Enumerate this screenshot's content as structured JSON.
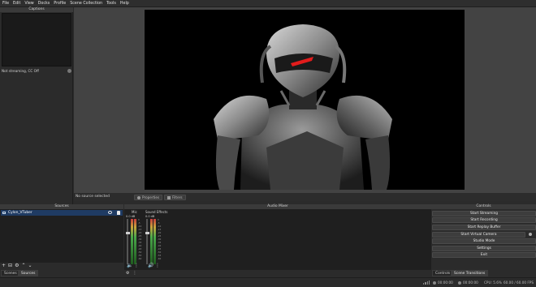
{
  "menu": [
    "File",
    "Edit",
    "View",
    "Docks",
    "Profile",
    "Scene Collection",
    "Tools",
    "Help"
  ],
  "captions": {
    "title": "Captions",
    "status": "Not streaming, CC Off"
  },
  "source_toolbar": {
    "no_source": "No source selected",
    "properties": "Properties",
    "filters": "Filters"
  },
  "sources": {
    "title": "Sources",
    "items": [
      "Cylon_VTuber"
    ],
    "toolbar_icons": [
      "+",
      "⊟",
      "⚙",
      "⌃",
      "⌄"
    ]
  },
  "tabs_left": [
    "Scenes",
    "Sources"
  ],
  "audio_mixer": {
    "title": "Audio Mixer",
    "channels": [
      {
        "name": "Mic",
        "db": "0.0 dB",
        "level": 0.72
      },
      {
        "name": "Sound Effects",
        "db": "0.0 dB",
        "level": 0.72
      }
    ],
    "scale": [
      "0",
      "-5",
      "-10",
      "-15",
      "-20",
      "-25",
      "-30",
      "-35",
      "-40",
      "-45",
      "-50",
      "-55",
      "-60"
    ]
  },
  "controls": {
    "title": "Controls",
    "buttons": [
      "Start Streaming",
      "Start Recording",
      "Start Replay Buffer",
      "Start Virtual Camera",
      "Studio Mode",
      "Settings",
      "Exit"
    ]
  },
  "tabs_right": [
    "Controls",
    "Scene Transitions"
  ],
  "status": {
    "stream_time": "00:00:00",
    "rec_time": "00:00:00",
    "cpu": "CPU: 5.6%",
    "fps": "60.00 / 60.00 FPS"
  },
  "colors": {
    "accent_selected": "#1f3b63",
    "panel": "#2b2b2b",
    "canvas": "#000000"
  }
}
